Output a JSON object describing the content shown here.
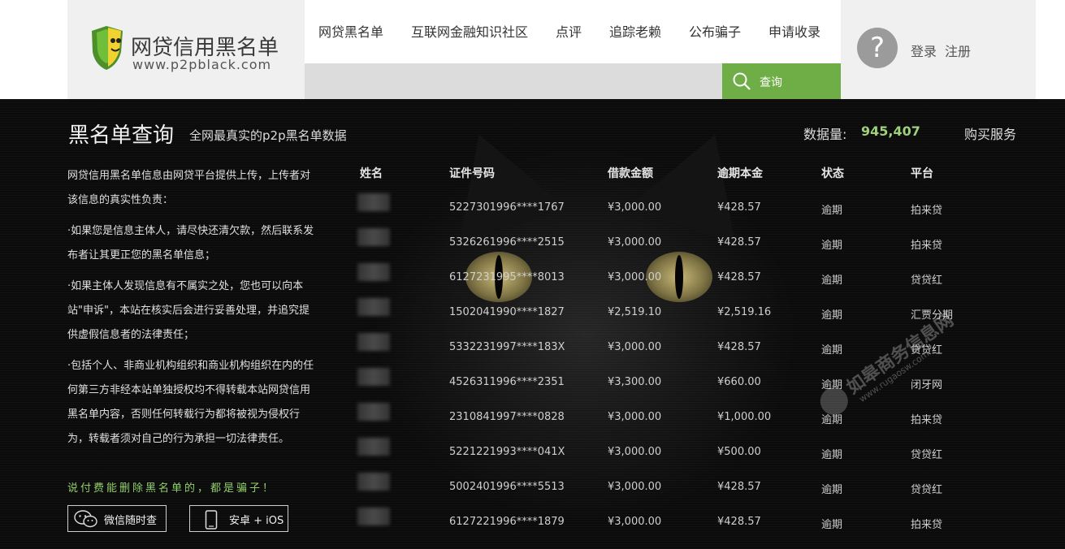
{
  "logo": {
    "title": "网贷信用黑名单",
    "url": "www.p2pblack.com"
  },
  "nav": {
    "items": [
      "网贷黑名单",
      "互联网金融知识社区",
      "点评",
      "追踪老赖",
      "公布骗子",
      "申请收录"
    ]
  },
  "search": {
    "button_label": "查询"
  },
  "user": {
    "avatar_glyph": "?",
    "login": "登录",
    "register": "注册"
  },
  "main": {
    "title": "黑名单查询",
    "subtitle": "全网最真实的p2p黑名单数据",
    "count_label": "数据量:",
    "count_value": "945,407",
    "buy_service": "购买服务"
  },
  "notice": {
    "paragraphs": [
      "网贷信用黑名单信息由网贷平台提供上传，上传者对该信息的真实性负责：",
      "·如果您是信息主体人，请尽快还清欠款，然后联系发布者让其更正您的黑名单信息；",
      "·如果主体人发现信息有不属实之处，您也可以向本站\"申诉\"，本站在核实后会进行妥善处理，并追究提供虚假信息者的法律责任；",
      "·包括个人、非商业机构组织和商业机构组织在内的任何第三方非经本站单独授权均不得转载本站网贷信用黑名单内容，否则任何转载行为都将被视为侵权行为，转载者须对自己的行为承担一切法律责任。"
    ],
    "warning": "说付费能删除黑名单的，都是骗子！",
    "wechat_button": "微信随时查",
    "mobile_button": "安卓 + iOS"
  },
  "table": {
    "headers": [
      "姓名",
      "证件号码",
      "借款金额",
      "逾期本金",
      "状态",
      "平台"
    ],
    "rows": [
      {
        "id": "5227301996****1767",
        "amount": "¥3,000.00",
        "overdue": "¥428.57",
        "status": "逾期",
        "platform": "拍来贷"
      },
      {
        "id": "5326261996****2515",
        "amount": "¥3,000.00",
        "overdue": "¥428.57",
        "status": "逾期",
        "platform": "拍来贷"
      },
      {
        "id": "6127231995****8013",
        "amount": "¥3,000.00",
        "overdue": "¥428.57",
        "status": "逾期",
        "platform": "贷贷红"
      },
      {
        "id": "1502041990****1827",
        "amount": "¥2,519.10",
        "overdue": "¥2,519.16",
        "status": "逾期",
        "platform": "汇贾分期"
      },
      {
        "id": "5332231997****183X",
        "amount": "¥3,000.00",
        "overdue": "¥428.57",
        "status": "逾期",
        "platform": "贷贷红"
      },
      {
        "id": "4526311996****2351",
        "amount": "¥3,300.00",
        "overdue": "¥660.00",
        "status": "逾期",
        "platform": "闭牙网"
      },
      {
        "id": "2310841997****0828",
        "amount": "¥3,000.00",
        "overdue": "¥1,000.00",
        "status": "逾期",
        "platform": "拍来贷"
      },
      {
        "id": "5221221993****041X",
        "amount": "¥3,000.00",
        "overdue": "¥500.00",
        "status": "逾期",
        "platform": "贷贷红"
      },
      {
        "id": "5002401996****5513",
        "amount": "¥3,000.00",
        "overdue": "¥428.57",
        "status": "逾期",
        "platform": "贷贷红"
      },
      {
        "id": "6127221996****1879",
        "amount": "¥3,000.00",
        "overdue": "¥428.57",
        "status": "逾期",
        "platform": "拍来贷"
      }
    ]
  },
  "watermark": {
    "text": "如皋商务信息网",
    "url": "www.rugaosw.com"
  },
  "colors": {
    "accent_green": "#6fad47",
    "count_green": "#9fd07a",
    "warning_green": "#8fd06a",
    "main_bg": "#0b0b0b"
  }
}
